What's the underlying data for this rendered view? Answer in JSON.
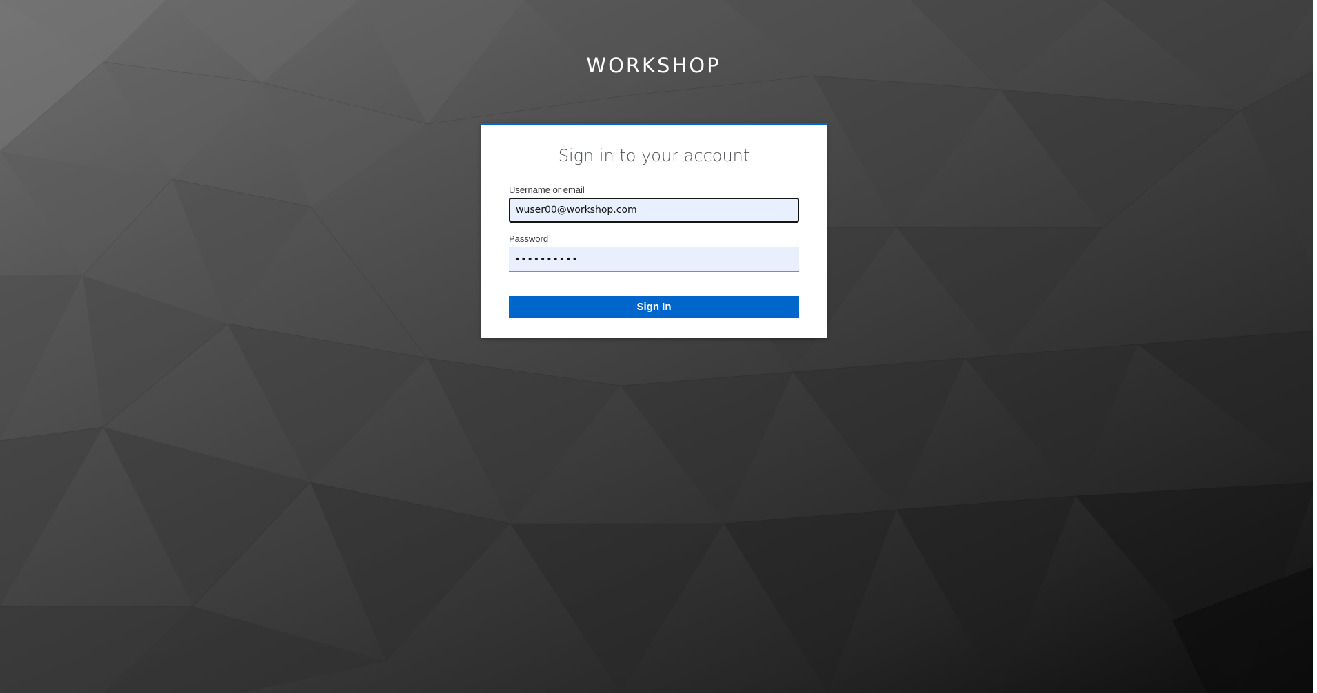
{
  "brand": {
    "title": "WORKSHOP"
  },
  "login_card": {
    "title": "Sign in to your account",
    "username_label": "Username or email",
    "username_value": "wuser00@workshop.com",
    "password_label": "Password",
    "password_value": "••••••••••",
    "submit_label": "Sign In"
  },
  "colors": {
    "accent": "#0066cc",
    "input_autofill_bg": "#e8f0fe"
  }
}
